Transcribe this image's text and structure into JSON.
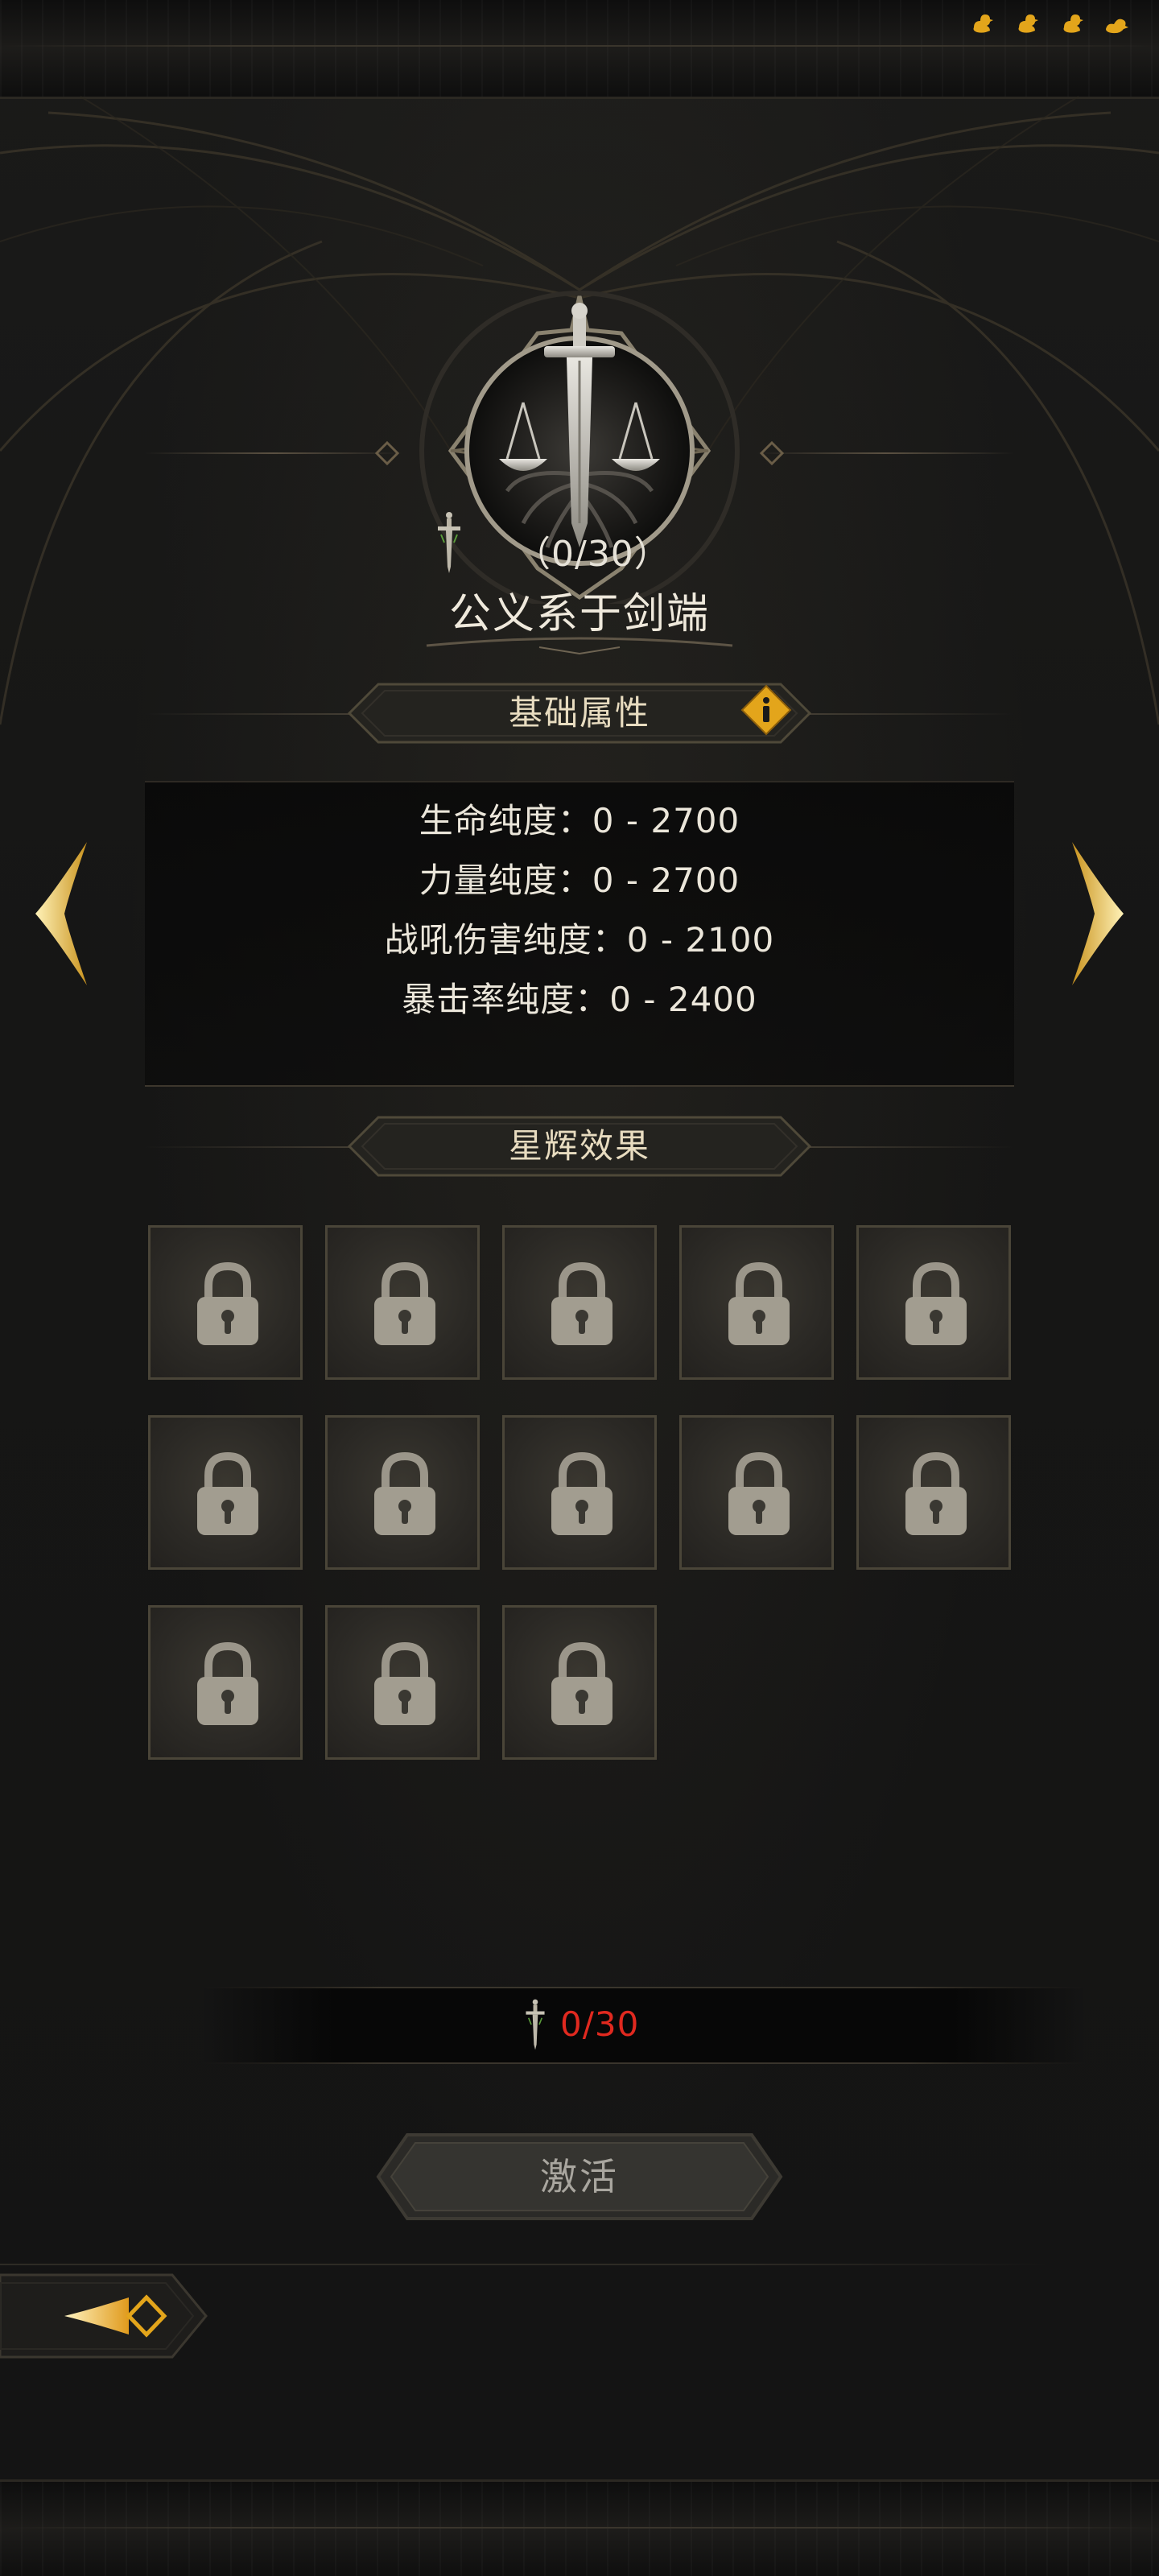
{
  "status_icons": [
    "duck-icon",
    "duck-icon",
    "duck-icon",
    "duck-icon"
  ],
  "skill": {
    "progress": "（0/30）",
    "title": "公义系于剑端"
  },
  "basic_attributes": {
    "header": "基础属性",
    "rows": [
      "生命纯度：0  -  2700",
      "力量纯度：0  -  2700",
      "战吼伤害纯度：0  -  2100",
      "暴击率纯度：0  -  2400"
    ]
  },
  "star_effects": {
    "header": "星辉效果",
    "slot_count": 13,
    "slot_state": "locked"
  },
  "progress_bar": {
    "count": "0/30",
    "value": 0,
    "max": 30
  },
  "activate_button": {
    "label": "激活"
  },
  "colors": {
    "accent_gold": "#e3a51b",
    "text_light": "#ebe6da",
    "progress_red": "#e0291f",
    "background": "#141414"
  }
}
